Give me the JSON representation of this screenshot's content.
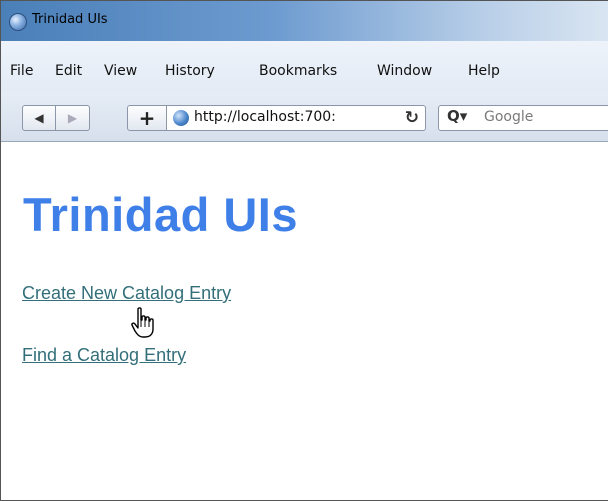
{
  "window": {
    "title": "Trinidad UIs"
  },
  "menu": {
    "items": [
      "File",
      "Edit",
      "View",
      "History",
      "Bookmarks",
      "Window",
      "Help"
    ]
  },
  "toolbar": {
    "back_glyph": "◀",
    "forward_glyph": "▶",
    "new_tab_glyph": "+",
    "url": "http://localhost:700:",
    "reload_glyph": "↻",
    "search_glyph": "Q▾",
    "search_placeholder": "Google"
  },
  "page": {
    "heading": "Trinidad UIs",
    "links": [
      {
        "label": "Create New Catalog Entry"
      },
      {
        "label": "Find a Catalog Entry"
      }
    ]
  },
  "colors": {
    "heading": "#3f7fe8",
    "link": "#336f79"
  },
  "icons": {
    "app": "browser-logo-icon",
    "site": "globe-icon",
    "cursor": "hand-pointer-icon"
  }
}
